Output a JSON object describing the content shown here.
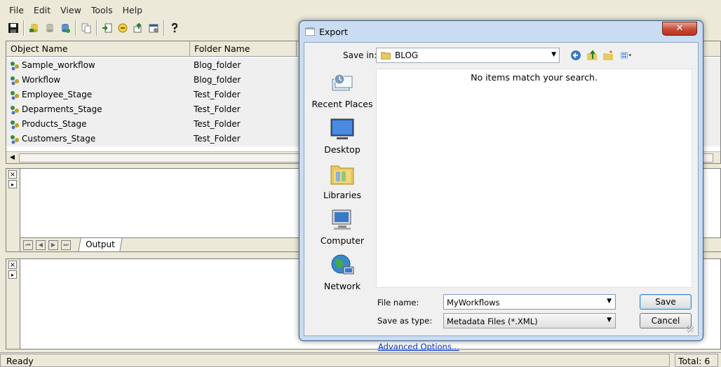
{
  "menu": [
    "File",
    "Edit",
    "View",
    "Tools",
    "Help"
  ],
  "columns": {
    "object_name": "Object Name",
    "folder_name": "Folder Name"
  },
  "objects": [
    {
      "name": "Sample_workflow",
      "folder": "Blog_folder"
    },
    {
      "name": "Workflow",
      "folder": "Blog_folder"
    },
    {
      "name": "Employee_Stage",
      "folder": "Test_Folder"
    },
    {
      "name": "Deparments_Stage",
      "folder": "Test_Folder"
    },
    {
      "name": "Products_Stage",
      "folder": "Test_Folder"
    },
    {
      "name": "Customers_Stage",
      "folder": "Test_Folder"
    }
  ],
  "output_tab": "Output",
  "status": {
    "left": "Ready",
    "right": "Total: 6"
  },
  "dialog": {
    "title": "Export",
    "close_glyph": "✕",
    "save_in_label": "Save in:",
    "save_in_value": "BLOG",
    "empty_message": "No items match your search.",
    "places": [
      "Recent Places",
      "Desktop",
      "Libraries",
      "Computer",
      "Network"
    ],
    "file_name_label": "File name:",
    "file_name_value": "MyWorkflows",
    "save_type_label": "Save as type:",
    "save_type_value": "Metadata Files (*.XML)",
    "save_button": "Save",
    "cancel_button": "Cancel",
    "advanced_link": "Advanced Options..."
  },
  "colors": {
    "accent": "#3c7fb1",
    "link": "#0033cc",
    "dialog_frame": "#c9dcf2"
  }
}
